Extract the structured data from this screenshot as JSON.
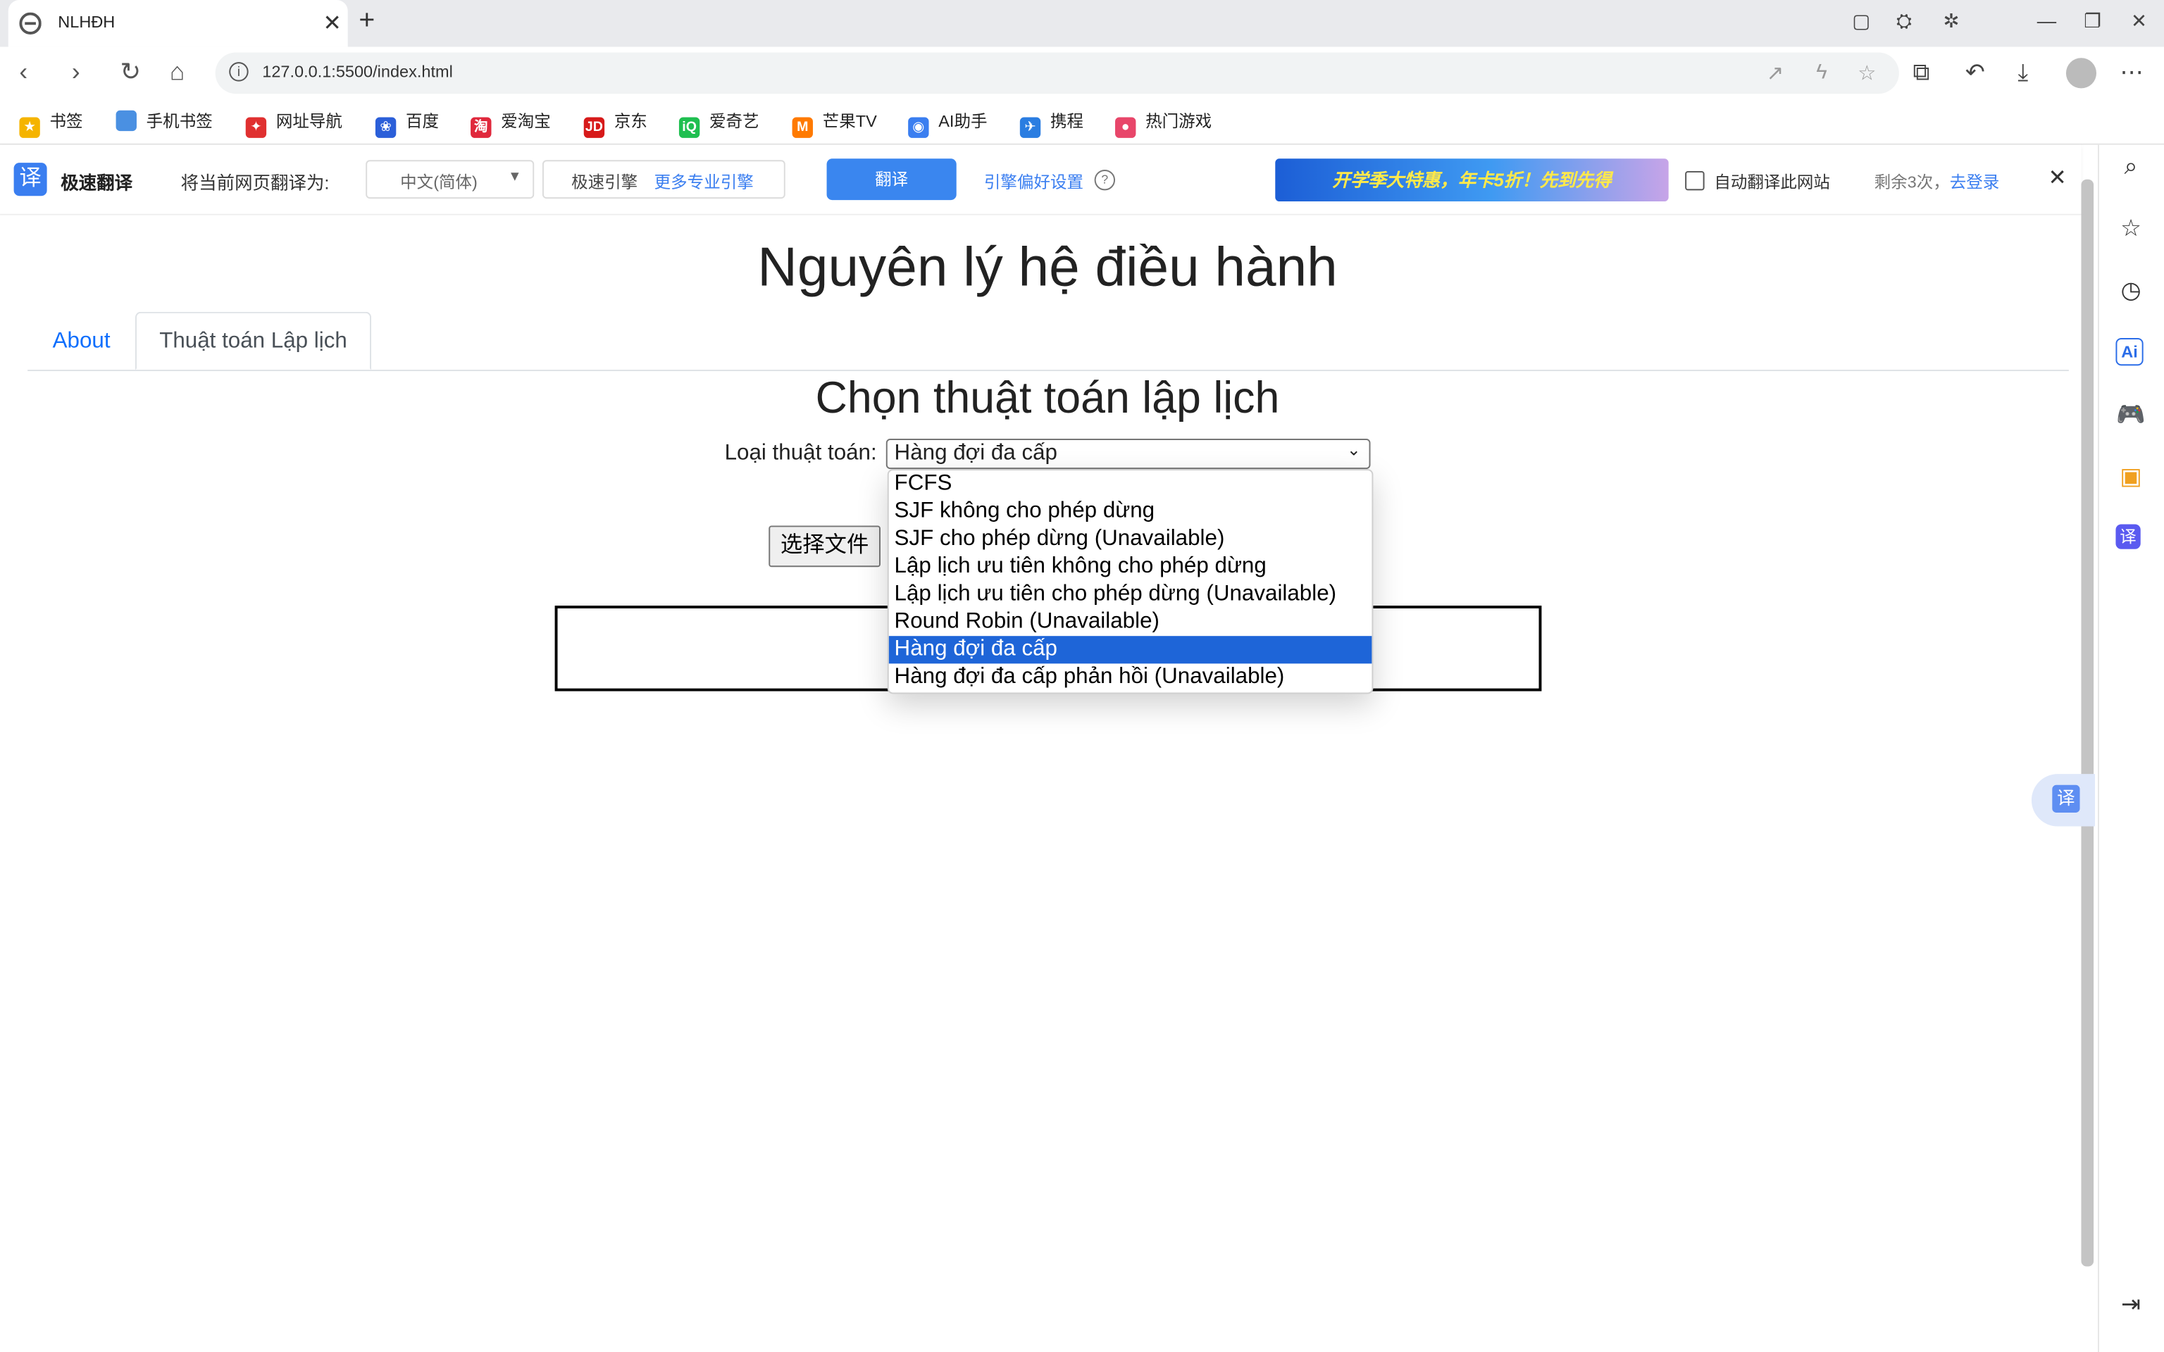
{
  "browser": {
    "tab_title": "NLHĐH",
    "url": "127.0.0.1:5500/index.html"
  },
  "bookmarks": [
    {
      "label": "书签",
      "icon": "star-icon",
      "color": "#f5b400"
    },
    {
      "label": "手机书签",
      "icon": "phone-icon",
      "color": "#4a90e2"
    },
    {
      "label": "网址导航",
      "icon": "nav-icon",
      "color": "#e03030"
    },
    {
      "label": "百度",
      "icon": "baidu-icon",
      "color": "#2b5fd9"
    },
    {
      "label": "爱淘宝",
      "icon": "taobao-icon",
      "color": "#e0283c"
    },
    {
      "label": "京东",
      "icon": "jd-icon",
      "color": "#d71a1a"
    },
    {
      "label": "爱奇艺",
      "icon": "iqiyi-icon",
      "color": "#1fbf50"
    },
    {
      "label": "芒果TV",
      "icon": "mango-icon",
      "color": "#ff7a00"
    },
    {
      "label": "AI助手",
      "icon": "ai-icon",
      "color": "#3a7ef0"
    },
    {
      "label": "携程",
      "icon": "ctrip-icon",
      "color": "#2a7de1"
    },
    {
      "label": "热门游戏",
      "icon": "game-icon",
      "color": "#e8466a"
    }
  ],
  "translate_bar": {
    "brand": "极速翻译",
    "prompt": "将当前网页翻译为:",
    "language": "中文(简体)",
    "engine": "极速引擎",
    "more_engines": "更多专业引擎",
    "translate_button": "翻译",
    "preferences": "引擎偏好设置",
    "banner": "开学季大特惠，年卡5折！先到先得",
    "auto_translate": "自动翻译此网站",
    "remaining": "剩余3次，",
    "login": "去登录"
  },
  "page": {
    "title": "Nguyên lý hệ điều hành",
    "tabs": [
      {
        "label": "About",
        "active": false
      },
      {
        "label": "Thuật toán Lập lịch",
        "active": true
      }
    ],
    "section_title": "Chọn thuật toán lập lịch",
    "algorithm_label": "Loại thuật toán:",
    "selected_algorithm": "Hàng đợi đa cấp",
    "file_button": "选择文件",
    "options": [
      "FCFS",
      "SJF không cho phép dừng",
      "SJF cho phép dừng (Unavailable)",
      "Lập lịch ưu tiên không cho phép dừng",
      "Lập lịch ưu tiên cho phép dừng (Unavailable)",
      "Round Robin (Unavailable)",
      "Hàng đợi đa cấp",
      "Hàng đợi đa cấp phản hồi (Unavailable)"
    ],
    "selected_index": 6
  },
  "colors": {
    "accent": "#3a86ef",
    "selected_option": "#1e65d8",
    "link": "#0d6efd"
  }
}
